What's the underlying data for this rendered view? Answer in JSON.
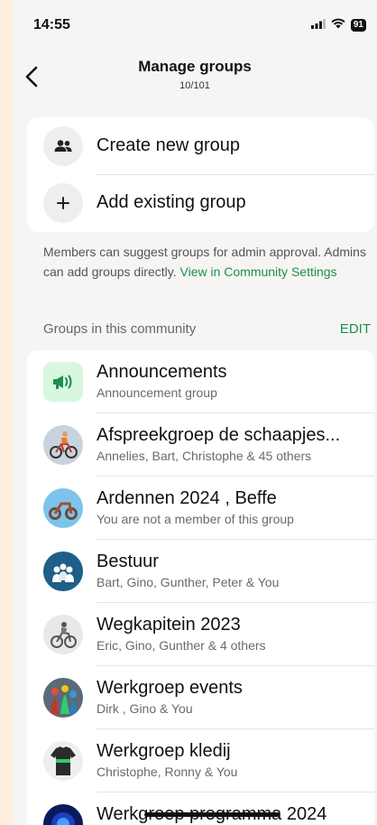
{
  "status": {
    "time": "14:55",
    "battery": "91"
  },
  "nav": {
    "title": "Manage groups",
    "subtitle": "10/101"
  },
  "actions": [
    {
      "label": "Create new group",
      "icon": "people-icon"
    },
    {
      "label": "Add existing group",
      "icon": "plus-icon"
    }
  ],
  "info": {
    "text": "Members can suggest groups for admin approval. Admins can add groups directly. ",
    "link": "View in Community Settings"
  },
  "section": {
    "title": "Groups in this community",
    "edit": "EDIT"
  },
  "groups": [
    {
      "name": "Announcements",
      "sub": "Announcement group"
    },
    {
      "name": "Afspreekgroep de schaapjes...",
      "sub": "Annelies, Bart, Christophe & 45 others"
    },
    {
      "name": "Ardennen 2024 , Beffe",
      "sub": "You are not a member of this group"
    },
    {
      "name": "Bestuur",
      "sub": "Bart, Gino, Gunther, Peter & You"
    },
    {
      "name": "Wegkapitein 2023",
      "sub": "Eric, Gino, Gunther & 4 others"
    },
    {
      "name": "Werkgroep events",
      "sub": "Dirk , Gino & You"
    },
    {
      "name": "Werkgroep kledij",
      "sub": "Christophe, Ronny & You"
    },
    {
      "name": "Werkgroep programma 2024",
      "sub": ""
    }
  ],
  "colors": {
    "accent": "#1d8f4c",
    "background": "#f6f5f3"
  }
}
